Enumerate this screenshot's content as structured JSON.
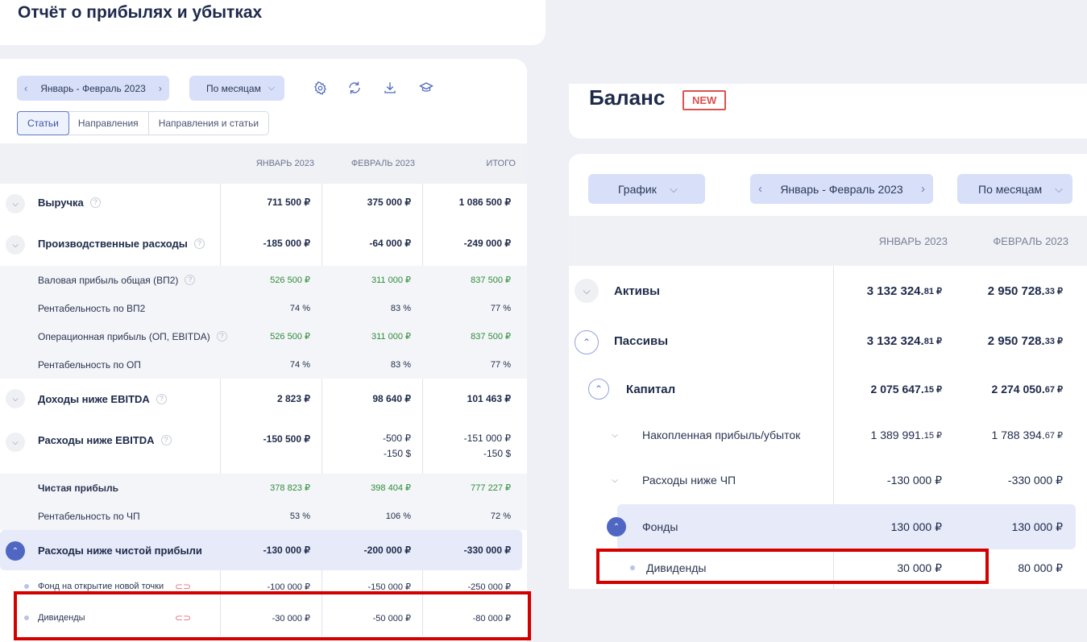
{
  "left": {
    "title": "Отчёт о прибылях и убытках",
    "period": "Январь - Февраль 2023",
    "grouping": "По месяцам",
    "tabs": [
      "Статьи",
      "Направления",
      "Направления и статьи"
    ],
    "columns": [
      "ЯНВАРЬ 2023",
      "ФЕВРАЛЬ 2023",
      "ИТОГО"
    ],
    "rows": [
      {
        "label": "Выручка",
        "v1": "711 500 ₽",
        "v2": "375 000 ₽",
        "v3": "1 086 500 ₽"
      },
      {
        "label": "Производственные расходы",
        "v1": "-185 000 ₽",
        "v2": "-64 000 ₽",
        "v3": "-249 000 ₽"
      },
      {
        "label": "Валовая прибыль общая (ВП2)",
        "v1": "526 500 ₽",
        "v2": "311 000 ₽",
        "v3": "837 500 ₽"
      },
      {
        "label": "Рентабельность по ВП2",
        "v1": "74 %",
        "v2": "83 %",
        "v3": "77 %"
      },
      {
        "label": "Операционная прибыль (ОП, EBITDA)",
        "v1": "526 500 ₽",
        "v2": "311 000 ₽",
        "v3": "837 500 ₽"
      },
      {
        "label": "Рентабельность по ОП",
        "v1": "74 %",
        "v2": "83 %",
        "v3": "77 %"
      },
      {
        "label": "Доходы ниже EBITDA",
        "v1": "2 823 ₽",
        "v2": "98 640 ₽",
        "v3": "101 463 ₽"
      },
      {
        "label": "Расходы ниже EBITDA",
        "v1": "-150 500 ₽",
        "v2a": "-500 ₽",
        "v2b": "-150 $",
        "v3a": "-151 000 ₽",
        "v3b": "-150 $"
      },
      {
        "label": "Чистая прибыль",
        "v1": "378 823 ₽",
        "v2": "398 404 ₽",
        "v3": "777 227 ₽"
      },
      {
        "label": "Рентабельность по ЧП",
        "v1": "53 %",
        "v2": "106 %",
        "v3": "72 %"
      },
      {
        "label": "Расходы ниже чистой прибыли",
        "v1": "-130 000 ₽",
        "v2": "-200 000 ₽",
        "v3": "-330 000 ₽"
      },
      {
        "label": "Фонд на открытие новой точки",
        "v1": "-100 000 ₽",
        "v2": "-150 000 ₽",
        "v3": "-250 000 ₽"
      },
      {
        "label": "Дивиденды",
        "v1": "-30 000 ₽",
        "v2": "-50 000 ₽",
        "v3": "-80 000 ₽"
      }
    ]
  },
  "right": {
    "title": "Баланс",
    "badge": "NEW",
    "chart_btn": "График",
    "period": "Январь - Февраль 2023",
    "grouping": "По месяцам",
    "columns": [
      "ЯНВАРЬ 2023",
      "ФЕВРАЛЬ 2023"
    ],
    "rows": [
      {
        "label": "Активы",
        "v1": "3 132 324.",
        "v1c": "81 ₽",
        "v2": "2 950 728.",
        "v2c": "33 ₽"
      },
      {
        "label": "Пассивы",
        "v1": "3 132 324.",
        "v1c": "81 ₽",
        "v2": "2 950 728.",
        "v2c": "33 ₽"
      },
      {
        "label": "Капитал",
        "v1": "2 075 647.",
        "v1c": "15 ₽",
        "v2": "2 274 050.",
        "v2c": "67 ₽"
      },
      {
        "label": "Накопленная прибыль/убыток",
        "v1": "1 389 991.",
        "v1c": "15 ₽",
        "v2": "1 788 394.",
        "v2c": "67 ₽"
      },
      {
        "label": "Расходы ниже ЧП",
        "v1": "-130 000 ₽",
        "v2": "-330 000 ₽"
      },
      {
        "label": "Фонды",
        "v1": "130 000 ₽",
        "v2": "130 000 ₽"
      },
      {
        "label": "Дивиденды",
        "v1": "30 000 ₽",
        "v2": "80 000 ₽"
      }
    ]
  }
}
